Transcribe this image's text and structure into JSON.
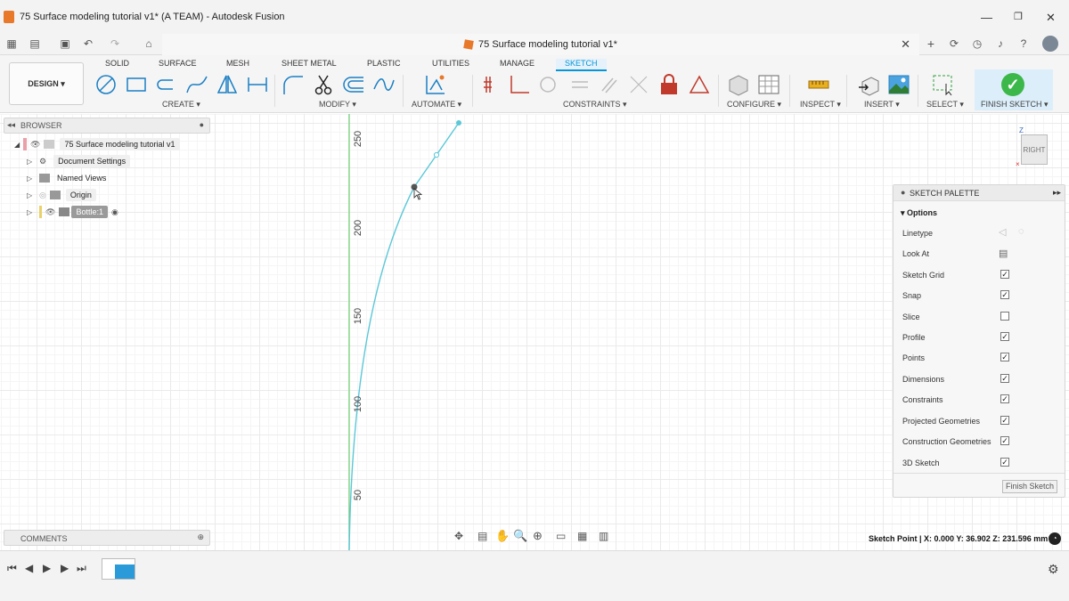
{
  "window": {
    "title": "75 Surface modeling tutorial v1* (A TEAM) - Autodesk Fusion"
  },
  "document_tab": {
    "title": "75 Surface modeling tutorial v1*"
  },
  "workspace": {
    "label": "DESIGN"
  },
  "ribbon_tabs": [
    "SOLID",
    "SURFACE",
    "MESH",
    "SHEET METAL",
    "PLASTIC",
    "UTILITIES",
    "MANAGE",
    "SKETCH"
  ],
  "ribbon_groups": {
    "create": "CREATE",
    "modify": "MODIFY",
    "automate": "AUTOMATE",
    "constraints": "CONSTRAINTS",
    "configure": "CONFIGURE",
    "inspect": "INSPECT",
    "insert": "INSERT",
    "select": "SELECT",
    "finish": "FINISH SKETCH"
  },
  "browser": {
    "title": "BROWSER",
    "items": [
      {
        "label": "75 Surface modeling tutorial v1",
        "icon": "document-icon"
      },
      {
        "label": "Document Settings",
        "icon": "gear-icon"
      },
      {
        "label": "Named Views",
        "icon": "folder-icon"
      },
      {
        "label": "Origin",
        "icon": "folder-icon"
      },
      {
        "label": "Bottle:1",
        "icon": "component-icon"
      }
    ]
  },
  "ruler": {
    "labels": [
      "250",
      "200",
      "150",
      "100",
      "50"
    ]
  },
  "palette": {
    "title": "SKETCH PALETTE",
    "section": "Options",
    "rows": [
      {
        "label": "Linetype",
        "type": "icons"
      },
      {
        "label": "Look At",
        "type": "icon"
      },
      {
        "label": "Sketch Grid",
        "checked": true
      },
      {
        "label": "Snap",
        "checked": true
      },
      {
        "label": "Slice",
        "checked": false
      },
      {
        "label": "Profile",
        "checked": true
      },
      {
        "label": "Points",
        "checked": true
      },
      {
        "label": "Dimensions",
        "checked": true
      },
      {
        "label": "Constraints",
        "checked": true
      },
      {
        "label": "Projected Geometries",
        "checked": true
      },
      {
        "label": "Construction Geometries",
        "checked": true
      },
      {
        "label": "3D Sketch",
        "checked": true
      }
    ],
    "finish_button": "Finish Sketch"
  },
  "viewcube": {
    "face": "RIGHT",
    "axis_z": "Z"
  },
  "comments": {
    "title": "COMMENTS"
  },
  "status": {
    "text": "Sketch Point | X: 0.000 Y: 36.902 Z: 231.596 mm"
  },
  "colors": {
    "accent": "#0696d7",
    "curve": "#5bc8d8",
    "finish_green": "#3cb84a"
  }
}
